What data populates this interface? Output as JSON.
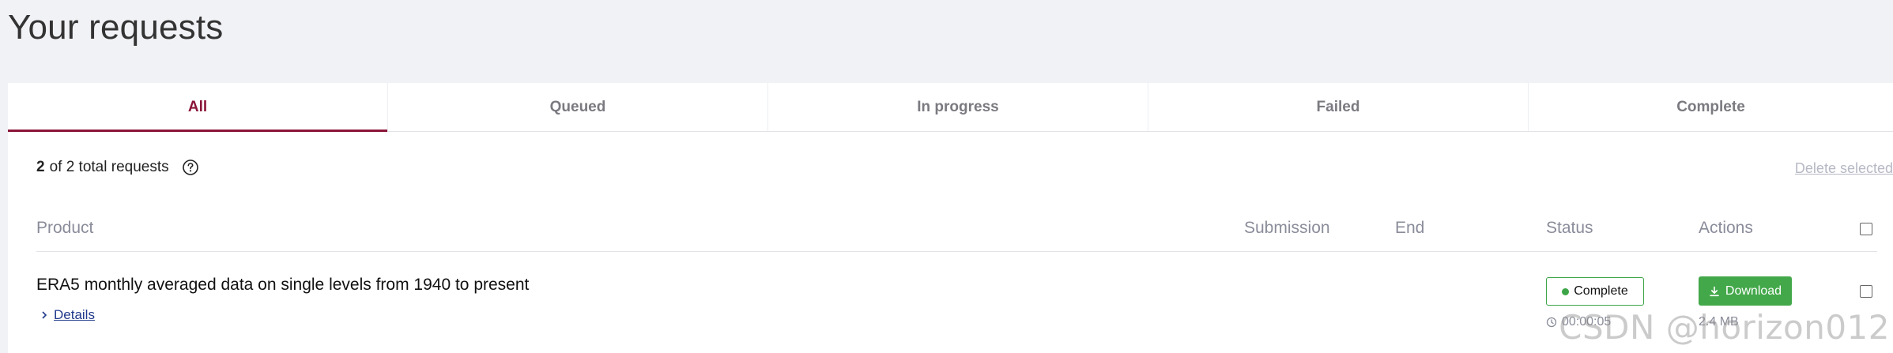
{
  "page": {
    "title": "Your requests"
  },
  "tabs": [
    {
      "label": "All",
      "active": true
    },
    {
      "label": "Queued",
      "active": false
    },
    {
      "label": "In progress",
      "active": false
    },
    {
      "label": "Failed",
      "active": false
    },
    {
      "label": "Complete",
      "active": false
    }
  ],
  "summary": {
    "shown": "2",
    "of_text": "of 2 total requests"
  },
  "actions": {
    "delete_selected": "Delete selected"
  },
  "table": {
    "columns": {
      "product": "Product",
      "submission": "Submission",
      "end": "End",
      "status": "Status",
      "actions": "Actions"
    },
    "rows": [
      {
        "product": "ERA5 monthly averaged data on single levels from 1940 to present",
        "details_label": "Details",
        "submission": "",
        "end": "",
        "status": "Complete",
        "duration": "00:00:05",
        "action_label": "Download",
        "size": "2.4 MB"
      }
    ]
  },
  "icons": {
    "help": "help-circle-icon",
    "chevron": "chevron-right-icon",
    "clock": "clock-icon",
    "download": "download-icon",
    "status_dot": "status-dot-icon"
  },
  "colors": {
    "accent": "#8a1538",
    "success": "#43a84a",
    "muted": "#8a8c9a",
    "link": "#223a8c",
    "background": "#f1f2f6"
  },
  "watermark": "CSDN @horizon012"
}
